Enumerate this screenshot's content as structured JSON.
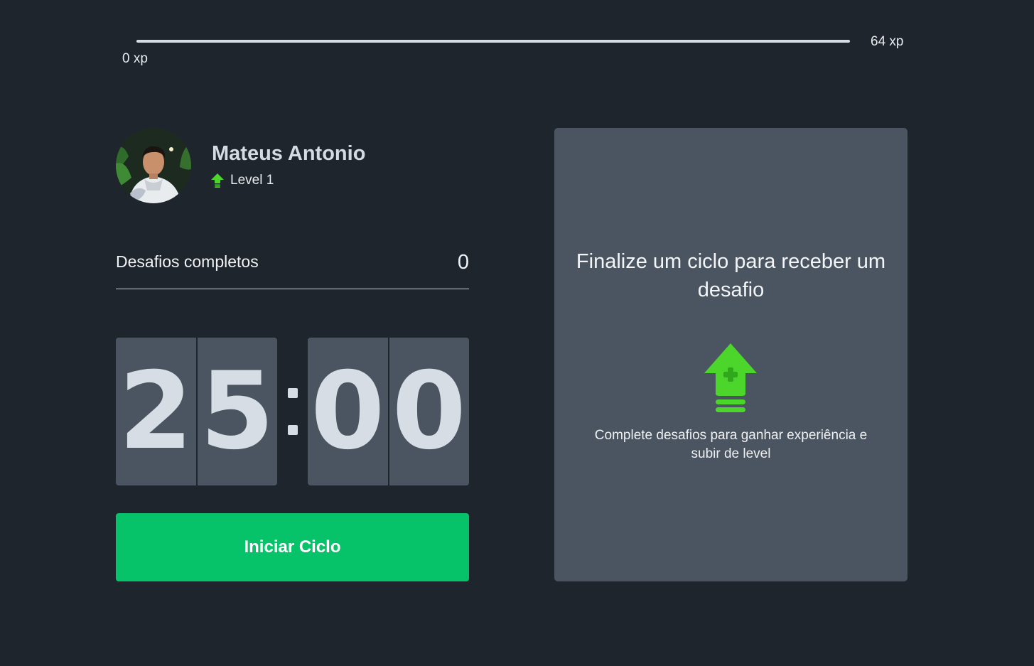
{
  "experience": {
    "min_label": "0 xp",
    "max_label": "64 xp",
    "current_fraction": 0
  },
  "profile": {
    "name": "Mateus Antonio",
    "level_label": "Level 1",
    "level_icon": "level-up-arrow-icon",
    "accent_color": "#4cd62b"
  },
  "challenges": {
    "label": "Desafios completos",
    "count": "0"
  },
  "countdown": {
    "minute_tens": "2",
    "minute_ones": "5",
    "second_tens": "0",
    "second_ones": "0"
  },
  "start_button": {
    "label": "Iniciar Ciclo",
    "color": "#06c36a"
  },
  "challenge_card": {
    "title": "Finalize um ciclo para receber um desafio",
    "icon": "level-up-icon",
    "description": "Complete desafios para ganhar experiência e subir de level"
  }
}
